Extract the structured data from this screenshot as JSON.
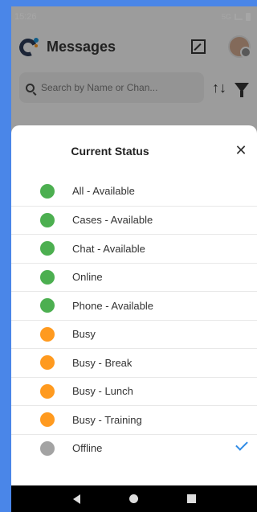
{
  "status_bar": {
    "time": "15:26",
    "icons_text": "5G"
  },
  "header": {
    "title": "Messages",
    "compose_icon": "compose-icon",
    "avatar_icon": "user-avatar"
  },
  "search": {
    "placeholder": "Search by Name or Chan...",
    "sort_icon": "↑↓"
  },
  "sheet": {
    "title": "Current Status",
    "close_label": "✕",
    "items": [
      {
        "label": "All - Available",
        "color": "#4caf50",
        "selected": false
      },
      {
        "label": "Cases - Available",
        "color": "#4caf50",
        "selected": false
      },
      {
        "label": "Chat - Available",
        "color": "#4caf50",
        "selected": false
      },
      {
        "label": "Online",
        "color": "#4caf50",
        "selected": false
      },
      {
        "label": "Phone - Available",
        "color": "#4caf50",
        "selected": false
      },
      {
        "label": "Busy",
        "color": "#ff9a1f",
        "selected": false
      },
      {
        "label": "Busy - Break",
        "color": "#ff9a1f",
        "selected": false
      },
      {
        "label": "Busy - Lunch",
        "color": "#ff9a1f",
        "selected": false
      },
      {
        "label": "Busy - Training",
        "color": "#ff9a1f",
        "selected": false
      },
      {
        "label": "Offline",
        "color": "#a3a3a3",
        "selected": true
      }
    ]
  },
  "colors": {
    "accent": "#2f8be6",
    "frame": "#4a86e8"
  }
}
